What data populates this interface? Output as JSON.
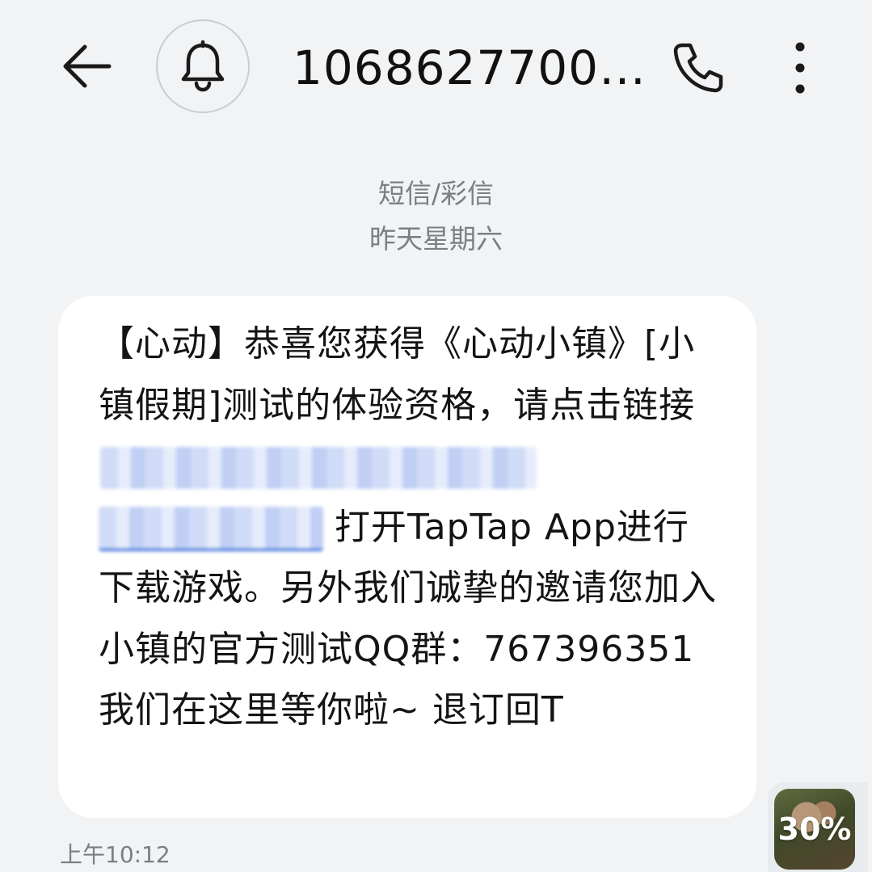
{
  "header": {
    "back_icon": "arrow-left-icon",
    "notify_icon": "bell-icon",
    "contact_number": "1068627700…",
    "call_icon": "phone-icon",
    "more_icon": "more-vertical-icon"
  },
  "conversation": {
    "channel_label": "短信/彩信",
    "date_label": "昨天星期六"
  },
  "message": {
    "text_part1": "【心动】恭喜您获得《心动小镇》[小镇假期]测试的体验资格，请点击链接",
    "text_part2": "打开TapTap App进行下载游戏。另外我们诚挚的邀请您加入小镇的官方测试QQ群：767396351 我们在这里等你啦~ 退订回T",
    "time": "上午10:12"
  },
  "floating_widget": {
    "progress_label": "30%",
    "progress_fraction": 0.3
  },
  "colors": {
    "background": "#f1f3f5",
    "bubble": "#ffffff",
    "link_underline": "#3c6fd8",
    "meta_text": "#7a7f85"
  }
}
